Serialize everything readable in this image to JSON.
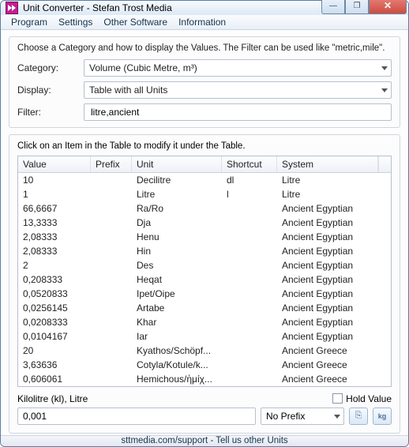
{
  "window": {
    "title": "Unit Converter - Stefan Trost Media"
  },
  "menu": {
    "program": "Program",
    "settings": "Settings",
    "other": "Other Software",
    "info": "Information"
  },
  "top": {
    "instruction": "Choose a Category and how to display the Values. The Filter can be used like \"metric,mile\".",
    "category_label": "Category:",
    "category_value": "Volume (Cubic Metre, m³)",
    "display_label": "Display:",
    "display_value": "Table with all Units",
    "filter_label": "Filter:",
    "filter_value": "litre,ancient"
  },
  "table": {
    "instruction": "Click on an Item in the Table to modify it under the Table.",
    "headers": {
      "value": "Value",
      "prefix": "Prefix",
      "unit": "Unit",
      "shortcut": "Shortcut",
      "system": "System"
    },
    "rows": [
      {
        "value": "10",
        "prefix": "",
        "unit": "Decilitre",
        "shortcut": "dl",
        "system": "Litre"
      },
      {
        "value": "1",
        "prefix": "",
        "unit": "Litre",
        "shortcut": "l",
        "system": "Litre"
      },
      {
        "value": "66,6667",
        "prefix": "",
        "unit": "Ra/Ro",
        "shortcut": "",
        "system": "Ancient Egyptian"
      },
      {
        "value": "13,3333",
        "prefix": "",
        "unit": "Dja",
        "shortcut": "",
        "system": "Ancient Egyptian"
      },
      {
        "value": "2,08333",
        "prefix": "",
        "unit": "Henu",
        "shortcut": "",
        "system": "Ancient Egyptian"
      },
      {
        "value": "2,08333",
        "prefix": "",
        "unit": "Hin",
        "shortcut": "",
        "system": "Ancient Egyptian"
      },
      {
        "value": "2",
        "prefix": "",
        "unit": "Des",
        "shortcut": "",
        "system": "Ancient Egyptian"
      },
      {
        "value": "0,208333",
        "prefix": "",
        "unit": "Heqat",
        "shortcut": "",
        "system": "Ancient Egyptian"
      },
      {
        "value": "0,0520833",
        "prefix": "",
        "unit": "Ipet/Oipe",
        "shortcut": "",
        "system": "Ancient Egyptian"
      },
      {
        "value": "0,0256145",
        "prefix": "",
        "unit": "Artabe",
        "shortcut": "",
        "system": "Ancient Egyptian"
      },
      {
        "value": "0,0208333",
        "prefix": "",
        "unit": "Khar",
        "shortcut": "",
        "system": "Ancient Egyptian"
      },
      {
        "value": "0,0104167",
        "prefix": "",
        "unit": "Iar",
        "shortcut": "",
        "system": "Ancient Egyptian"
      },
      {
        "value": "20",
        "prefix": "",
        "unit": "Kyathos/Schöpf...",
        "shortcut": "",
        "system": "Ancient Greece"
      },
      {
        "value": "3,63636",
        "prefix": "",
        "unit": "Cotyla/Kotule/k...",
        "shortcut": "",
        "system": "Ancient Greece"
      },
      {
        "value": "0,606061",
        "prefix": "",
        "unit": "Hemichous/ἡμίχ...",
        "shortcut": "",
        "system": "Ancient Greece"
      }
    ]
  },
  "bottom": {
    "selected_unit": "Kilolitre (kl), Litre",
    "hold_value_label": "Hold Value",
    "value_text": "0,001",
    "prefix_value": "No Prefix"
  },
  "footer": {
    "text": "sttmedia.com/support - Tell us other Units"
  },
  "icons": {
    "copy": "⎘",
    "kg": "kg"
  }
}
